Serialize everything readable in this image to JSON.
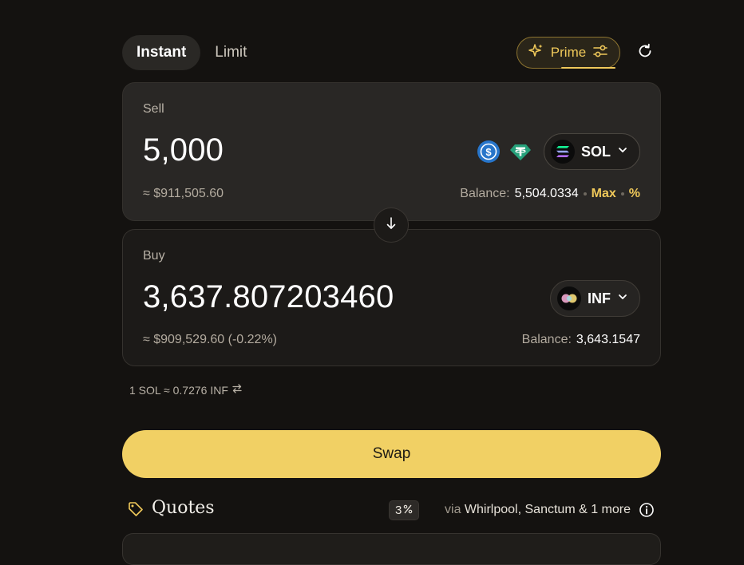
{
  "tabs": [
    {
      "label": "Instant",
      "active": true
    },
    {
      "label": "Limit",
      "active": false
    }
  ],
  "prime": {
    "label": "Prime",
    "icon": "sparkle-icon",
    "settings_icon": "sliders-icon",
    "color": "#f0c95a"
  },
  "refresh_icon": "refresh-icon",
  "sell": {
    "label": "Sell",
    "amount": "5,000",
    "usd": "≈ $911,505.60",
    "quick_tokens": [
      "usdc-icon",
      "usdt-icon"
    ],
    "token": "SOL",
    "balance_label": "Balance:",
    "balance": "5,504.0334",
    "max_label": "Max",
    "percent_label": "%"
  },
  "flip_icon": "arrow-down-icon",
  "buy": {
    "label": "Buy",
    "amount": "3,637.807203460",
    "usd": "≈ $909,529.60 (-0.22%)",
    "token": "INF",
    "balance_label": "Balance:",
    "balance": "3,643.1547"
  },
  "rate": {
    "text": "1 SOL ≈ 0.7276 INF",
    "icon": "swap-arrows-icon"
  },
  "swap_button": {
    "label": "Swap",
    "color": "#f1d064"
  },
  "quotes": {
    "title": "Quotes",
    "slippage": "3",
    "via_label": "via",
    "routes": "Whirlpool, Sanctum & 1 more"
  }
}
